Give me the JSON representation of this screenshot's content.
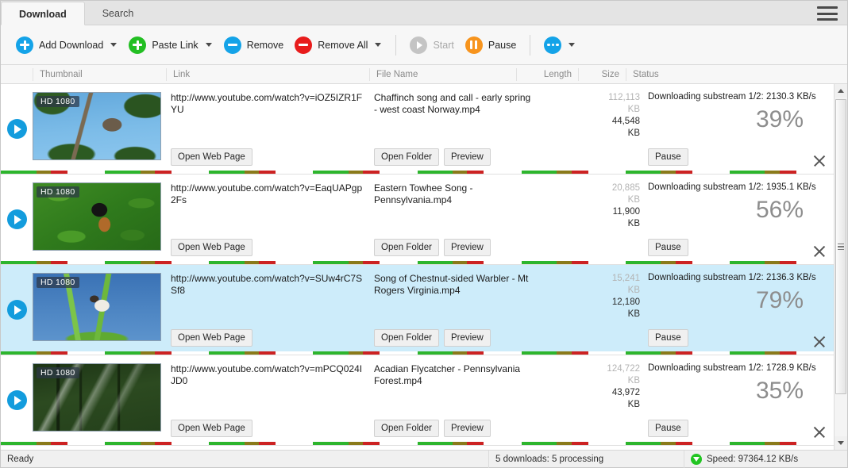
{
  "window": {
    "tabs": [
      {
        "label": "Download",
        "active": true
      },
      {
        "label": "Search",
        "active": false
      }
    ],
    "menu_icon": "hamburger-menu-icon"
  },
  "toolbar": {
    "items": [
      {
        "label": "Add Download",
        "icon": "plus-circle-blue-icon",
        "has_caret": true,
        "disabled": false
      },
      {
        "label": "Paste Link",
        "icon": "plus-circle-green-icon",
        "has_caret": true,
        "disabled": false
      },
      {
        "label": "Remove",
        "icon": "minus-circle-blue-icon",
        "has_caret": false,
        "disabled": false
      },
      {
        "label": "Remove All",
        "icon": "minus-circle-red-icon",
        "has_caret": true,
        "disabled": false
      },
      {
        "label": "Start",
        "icon": "play-circle-grey-icon",
        "has_caret": false,
        "disabled": true
      },
      {
        "label": "Pause",
        "icon": "pause-circle-orange-icon",
        "has_caret": false,
        "disabled": false
      },
      {
        "label": "",
        "icon": "more-dots-circle-blue-icon",
        "has_caret": true,
        "disabled": false
      }
    ]
  },
  "columns": [
    {
      "label": "Thumbnail"
    },
    {
      "label": "Link"
    },
    {
      "label": "File Name"
    },
    {
      "label": "Length"
    },
    {
      "label": "Size"
    },
    {
      "label": "Status"
    }
  ],
  "downloads": [
    {
      "quality_badge": "HD 1080",
      "link": "http://www.youtube.com/watch?v=iOZ5IZR1FYU",
      "file_name": "Chaffinch song and call - early spring - west coast Norway.mp4",
      "length": "",
      "size_total": "112,113 KB",
      "size_done": "44,548 KB",
      "status": "Downloading substream 1/2: 2130.3 KB/s",
      "percent": "39%",
      "open_web_page_label": "Open Web Page",
      "open_folder_label": "Open Folder",
      "preview_label": "Preview",
      "pause_label": "Pause",
      "selected": false,
      "thumb_art": "art1"
    },
    {
      "quality_badge": "HD 1080",
      "link": "http://www.youtube.com/watch?v=EaqUAPgp2Fs",
      "file_name": "Eastern Towhee Song - Pennsylvania.mp4",
      "length": "",
      "size_total": "20,885 KB",
      "size_done": "11,900 KB",
      "status": "Downloading substream 1/2: 1935.1 KB/s",
      "percent": "56%",
      "open_web_page_label": "Open Web Page",
      "open_folder_label": "Open Folder",
      "preview_label": "Preview",
      "pause_label": "Pause",
      "selected": false,
      "thumb_art": "art2"
    },
    {
      "quality_badge": "HD 1080",
      "link": "http://www.youtube.com/watch?v=SUw4rC7SSf8",
      "file_name": "Song of Chestnut-sided Warbler - Mt Rogers Virginia.mp4",
      "length": "",
      "size_total": "15,241 KB",
      "size_done": "12,180 KB",
      "status": "Downloading substream 1/2: 2136.3 KB/s",
      "percent": "79%",
      "open_web_page_label": "Open Web Page",
      "open_folder_label": "Open Folder",
      "preview_label": "Preview",
      "pause_label": "Pause",
      "selected": true,
      "thumb_art": "art3"
    },
    {
      "quality_badge": "HD 1080",
      "link": "http://www.youtube.com/watch?v=mPCQ024IJD0",
      "file_name": "Acadian Flycatcher - Pennsylvania Forest.mp4",
      "length": "",
      "size_total": "124,722 KB",
      "size_done": "43,972 KB",
      "status": "Downloading substream 1/2: 1728.9 KB/s",
      "percent": "35%",
      "open_web_page_label": "Open Web Page",
      "open_folder_label": "Open Folder",
      "preview_label": "Preview",
      "pause_label": "Pause",
      "selected": false,
      "thumb_art": "art4"
    }
  ],
  "statusbar": {
    "state": "Ready",
    "downloads_summary": "5 downloads: 5 processing",
    "speed": "Speed: 97364.12 KB/s",
    "speed_icon": "download-arrow-icon"
  },
  "colors": {
    "accent_blue": "#14a3e8",
    "accent_green": "#23bf23",
    "accent_red": "#e81c1c",
    "accent_orange": "#f7941d",
    "selection_blue": "#cdecfa",
    "progress_green": "#2db52d",
    "progress_olive": "#8a7a1a",
    "progress_red": "#cc2222"
  },
  "scrollbar": {
    "orientation": "vertical",
    "position": "top"
  }
}
